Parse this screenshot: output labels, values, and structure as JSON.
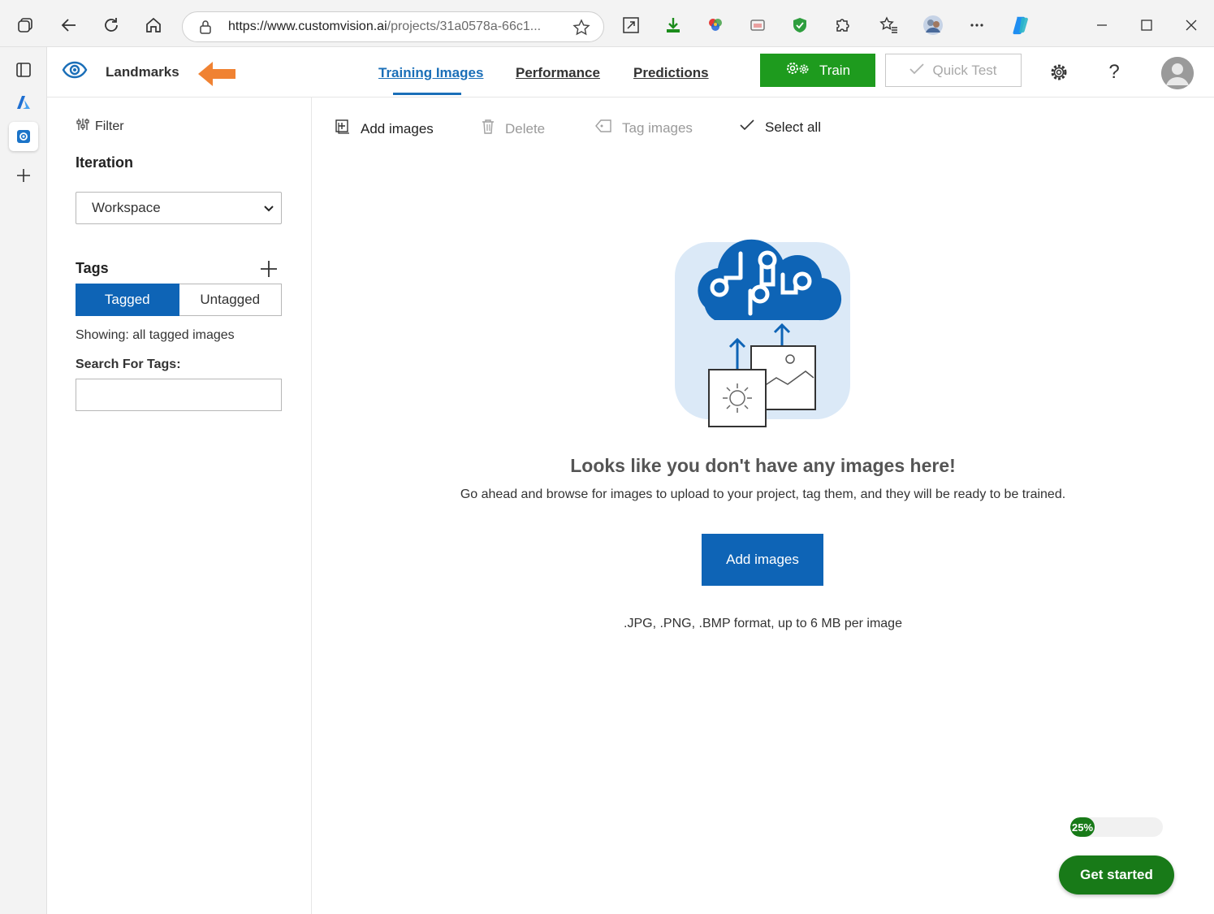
{
  "browser": {
    "url_main": "https://www.customvision.ai",
    "url_rest": "/projects/31a0578a-66c1..."
  },
  "header": {
    "project_name": "Landmarks",
    "tabs": [
      {
        "label": "Training Images",
        "active": true
      },
      {
        "label": "Performance",
        "active": false
      },
      {
        "label": "Predictions",
        "active": false
      }
    ],
    "train_label": "Train",
    "quick_test_label": "Quick Test",
    "help_label": "?"
  },
  "filter": {
    "filter_label": "Filter",
    "iteration_title": "Iteration",
    "iteration_value": "Workspace",
    "tags_title": "Tags",
    "tagged_label": "Tagged",
    "untagged_label": "Untagged",
    "showing_text": "Showing: all tagged images",
    "search_label": "Search For Tags:",
    "search_value": ""
  },
  "toolbar": {
    "add_images": "Add images",
    "delete": "Delete",
    "tag_images": "Tag images",
    "select_all": "Select all"
  },
  "empty_state": {
    "title": "Looks like you don't have any images here!",
    "description": "Go ahead and browse for images to upload to your project, tag them, and they will be ready to be trained.",
    "button": "Add images",
    "formats": ".JPG, .PNG, .BMP format, up to 6 MB per image"
  },
  "onboarding": {
    "progress_percent": 25,
    "progress_label": "25%",
    "get_started_label": "Get started"
  },
  "colors": {
    "accent_blue": "#0e64b6",
    "train_green": "#1e9b1e",
    "progress_green": "#187a18",
    "arrow_orange": "#f08232"
  }
}
